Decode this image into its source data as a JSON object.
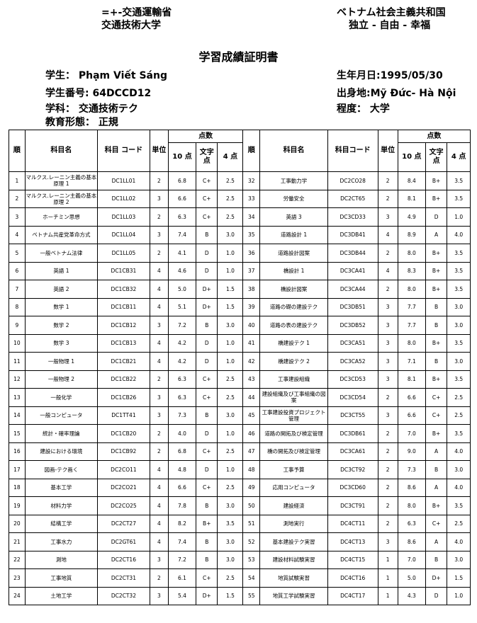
{
  "header": {
    "ministry": "=+-交通運輸省",
    "university": "交通技術大学",
    "country": "ベトナム社会主義共和国",
    "motto": "独立 - 自由 - 幸福",
    "doc_title": "学習成績証明書"
  },
  "student": {
    "name_label": "学生：",
    "name_value": "Phạm Viết Sáng",
    "id_label": "学生番号:",
    "id_value": "64DCCD12",
    "dept_label": "学科：",
    "dept_value": "交通技術テク",
    "edu_label": "教育形態：",
    "edu_value": "正規",
    "dob_label": "生年月日:",
    "dob_value": "1995/05/30",
    "origin_label": "出身地:",
    "origin_value": "Mỹ Đức- Hà Nội",
    "level_label": "程度：",
    "level_value": "大学"
  },
  "table": {
    "headers": {
      "no": "順",
      "subject_l": "科目名",
      "code_l": "科目 コード",
      "credit": "単位",
      "score": "点数",
      "s10": "10 点",
      "letter_l": "文字点",
      "s4": "4 点",
      "subject_r": "科目名",
      "code_r": "科目コード",
      "letter_r": "文字点"
    },
    "rows": [
      {
        "l": {
          "no": "1",
          "name": "マルクス.レーニン主義の基本原理 1",
          "code": "DC1LL01",
          "cr": "2",
          "s10": "6.8",
          "let": "C+",
          "s4": "2.5"
        },
        "r": {
          "no": "32",
          "name": "工事動力学",
          "code": "DC2CO28",
          "cr": "2",
          "s10": "8.4",
          "let": "B+",
          "s4": "3.5"
        }
      },
      {
        "l": {
          "no": "2",
          "name": "マルクス.レーニン主義の基本原理 2",
          "code": "DC1LL02",
          "cr": "3",
          "s10": "6.6",
          "let": "C+",
          "s4": "2.5"
        },
        "r": {
          "no": "33",
          "name": "労働安全",
          "code": "DC2CT65",
          "cr": "2",
          "s10": "8.1",
          "let": "B+",
          "s4": "3.5"
        }
      },
      {
        "l": {
          "no": "3",
          "name": "ホーチミン思想",
          "code": "DC1LL03",
          "cr": "2",
          "s10": "6.3",
          "let": "C+",
          "s4": "2.5"
        },
        "r": {
          "no": "34",
          "name": "英語 3",
          "code": "DC3CD33",
          "cr": "3",
          "s10": "4.9",
          "let": "D",
          "s4": "1.0"
        }
      },
      {
        "l": {
          "no": "4",
          "name": "ベトナム共産党革命方式",
          "code": "DC1LL04",
          "cr": "3",
          "s10": "7.4",
          "let": "B",
          "s4": "3.0"
        },
        "r": {
          "no": "35",
          "name": "道路設計 1",
          "code": "DC3DB41",
          "cr": "4",
          "s10": "8.9",
          "let": "A",
          "s4": "4.0"
        }
      },
      {
        "l": {
          "no": "5",
          "name": "一般ベトナム法律",
          "code": "DC1LL05",
          "cr": "2",
          "s10": "4.1",
          "let": "D",
          "s4": "1.0"
        },
        "r": {
          "no": "36",
          "name": "道路設計図案",
          "code": "DC3DB44",
          "cr": "2",
          "s10": "8.0",
          "let": "B+",
          "s4": "3.5"
        }
      },
      {
        "l": {
          "no": "6",
          "name": "英語 1",
          "code": "DC1CB31",
          "cr": "4",
          "s10": "4.6",
          "let": "D",
          "s4": "1.0"
        },
        "r": {
          "no": "37",
          "name": "橋設計 1",
          "code": "DC3CA41",
          "cr": "4",
          "s10": "8.3",
          "let": "B+",
          "s4": "3.5"
        }
      },
      {
        "l": {
          "no": "7",
          "name": "英語 2",
          "code": "DC1CB32",
          "cr": "4",
          "s10": "5.0",
          "let": "D+",
          "s4": "1.5"
        },
        "r": {
          "no": "38",
          "name": "橋設計図案",
          "code": "DC3CA44",
          "cr": "2",
          "s10": "8.0",
          "let": "B+",
          "s4": "3.5"
        }
      },
      {
        "l": {
          "no": "8",
          "name": "数学 1",
          "code": "DC1CB11",
          "cr": "4",
          "s10": "5.1",
          "let": "D+",
          "s4": "1.5"
        },
        "r": {
          "no": "39",
          "name": "道路の礎の建設テク",
          "code": "DC3DB51",
          "cr": "3",
          "s10": "7.7",
          "let": "B",
          "s4": "3.0"
        }
      },
      {
        "l": {
          "no": "9",
          "name": "数学 2",
          "code": "DC1CB12",
          "cr": "3",
          "s10": "7.2",
          "let": "B",
          "s4": "3.0"
        },
        "r": {
          "no": "40",
          "name": "道路の表の建設テク",
          "code": "DC3DB52",
          "cr": "3",
          "s10": "7.7",
          "let": "B",
          "s4": "3.0"
        }
      },
      {
        "l": {
          "no": "10",
          "name": "数学 3",
          "code": "DC1CB13",
          "cr": "4",
          "s10": "4.2",
          "let": "D",
          "s4": "1.0"
        },
        "r": {
          "no": "41",
          "name": "橋建設テク 1",
          "code": "DC3CA51",
          "cr": "3",
          "s10": "8.0",
          "let": "B+",
          "s4": "3.5"
        }
      },
      {
        "l": {
          "no": "11",
          "name": "一般物理 1",
          "code": "DC1CB21",
          "cr": "4",
          "s10": "4.2",
          "let": "D",
          "s4": "1.0"
        },
        "r": {
          "no": "42",
          "name": "橋建設テク 2",
          "code": "DC3CA52",
          "cr": "3",
          "s10": "7.1",
          "let": "B",
          "s4": "3.0"
        }
      },
      {
        "l": {
          "no": "12",
          "name": "一般物理 2",
          "code": "DC1CB22",
          "cr": "2",
          "s10": "6.3",
          "let": "C+",
          "s4": "2.5"
        },
        "r": {
          "no": "43",
          "name": "工事建設組織",
          "code": "DC3CD53",
          "cr": "3",
          "s10": "8.1",
          "let": "B+",
          "s4": "3.5"
        }
      },
      {
        "l": {
          "no": "13",
          "name": "一般化学",
          "code": "DC1CB26",
          "cr": "3",
          "s10": "6.3",
          "let": "C+",
          "s4": "2.5"
        },
        "r": {
          "no": "44",
          "name": "建設組織及び工事組織の図案",
          "code": "DC3CD54",
          "cr": "2",
          "s10": "6.6",
          "let": "C+",
          "s4": "2.5"
        }
      },
      {
        "l": {
          "no": "14",
          "name": "一般コンピュータ",
          "code": "DC1TT41",
          "cr": "3",
          "s10": "7.3",
          "let": "B",
          "s4": "3.0"
        },
        "r": {
          "no": "45",
          "name": "工事建設投資プロジェクト管理",
          "code": "DC3CT55",
          "cr": "3",
          "s10": "6.6",
          "let": "C+",
          "s4": "2.5"
        }
      },
      {
        "l": {
          "no": "15",
          "name": "統計・確率理論",
          "code": "DC1CB20",
          "cr": "2",
          "s10": "4.0",
          "let": "D",
          "s4": "1.0"
        },
        "r": {
          "no": "46",
          "name": "道路の開拓及び検定管理",
          "code": "DC3DB61",
          "cr": "2",
          "s10": "7.0",
          "let": "B+",
          "s4": "3.5"
        }
      },
      {
        "l": {
          "no": "16",
          "name": "建設における環境",
          "code": "DC1CB92",
          "cr": "2",
          "s10": "6.8",
          "let": "C+",
          "s4": "2.5"
        },
        "r": {
          "no": "47",
          "name": "橋の開拓及び検定管理",
          "code": "DC3CA61",
          "cr": "2",
          "s10": "9.0",
          "let": "A",
          "s4": "4.0"
        }
      },
      {
        "l": {
          "no": "17",
          "name": "図画-テク画く",
          "code": "DC2CO11",
          "cr": "4",
          "s10": "4.8",
          "let": "D",
          "s4": "1.0"
        },
        "r": {
          "no": "48",
          "name": "工事予算",
          "code": "DC3CT92",
          "cr": "2",
          "s10": "7.3",
          "let": "B",
          "s4": "3.0"
        }
      },
      {
        "l": {
          "no": "18",
          "name": "基本工学",
          "code": "DC2CO21",
          "cr": "4",
          "s10": "6.6",
          "let": "C+",
          "s4": "2.5"
        },
        "r": {
          "no": "49",
          "name": "応用コンピュータ",
          "code": "DC3CD60",
          "cr": "2",
          "s10": "8.6",
          "let": "A",
          "s4": "4.0"
        }
      },
      {
        "l": {
          "no": "19",
          "name": "材料力学",
          "code": "DC2CO25",
          "cr": "4",
          "s10": "7.8",
          "let": "B",
          "s4": "3.0"
        },
        "r": {
          "no": "50",
          "name": "建設経済",
          "code": "DC3CT91",
          "cr": "2",
          "s10": "8.0",
          "let": "B+",
          "s4": "3.5"
        }
      },
      {
        "l": {
          "no": "20",
          "name": "結構工学",
          "code": "DC2CT27",
          "cr": "4",
          "s10": "8.2",
          "let": "B+",
          "s4": "3.5"
        },
        "r": {
          "no": "51",
          "name": "測地実行",
          "code": "DC4CT11",
          "cr": "2",
          "s10": "6.3",
          "let": "C+",
          "s4": "2.5"
        }
      },
      {
        "l": {
          "no": "21",
          "name": "工事水力",
          "code": "DC2GT61",
          "cr": "4",
          "s10": "7.4",
          "let": "B",
          "s4": "3.0"
        },
        "r": {
          "no": "52",
          "name": "基本建設テク実習",
          "code": "DC4CT13",
          "cr": "3",
          "s10": "8.6",
          "let": "A",
          "s4": "4.0"
        }
      },
      {
        "l": {
          "no": "22",
          "name": "測地",
          "code": "DC2CT16",
          "cr": "3",
          "s10": "7.2",
          "let": "B",
          "s4": "3.0"
        },
        "r": {
          "no": "53",
          "name": "建設材料試験実習",
          "code": "DC4CT15",
          "cr": "1",
          "s10": "7.0",
          "let": "B",
          "s4": "3.0"
        }
      },
      {
        "l": {
          "no": "23",
          "name": "工事地質",
          "code": "DC2CT31",
          "cr": "2",
          "s10": "6.1",
          "let": "C+",
          "s4": "2.5"
        },
        "r": {
          "no": "54",
          "name": "地質試験実習",
          "code": "DC4CT16",
          "cr": "1",
          "s10": "5.0",
          "let": "D+",
          "s4": "1.5"
        }
      },
      {
        "l": {
          "no": "24",
          "name": "土地工学",
          "code": "DC2CT32",
          "cr": "3",
          "s10": "5.4",
          "let": "D+",
          "s4": "1.5"
        },
        "r": {
          "no": "55",
          "name": "地質工学試験実習",
          "code": "DC4CT17",
          "cr": "1",
          "s10": "4.3",
          "let": "D",
          "s4": "1.0"
        }
      }
    ]
  }
}
